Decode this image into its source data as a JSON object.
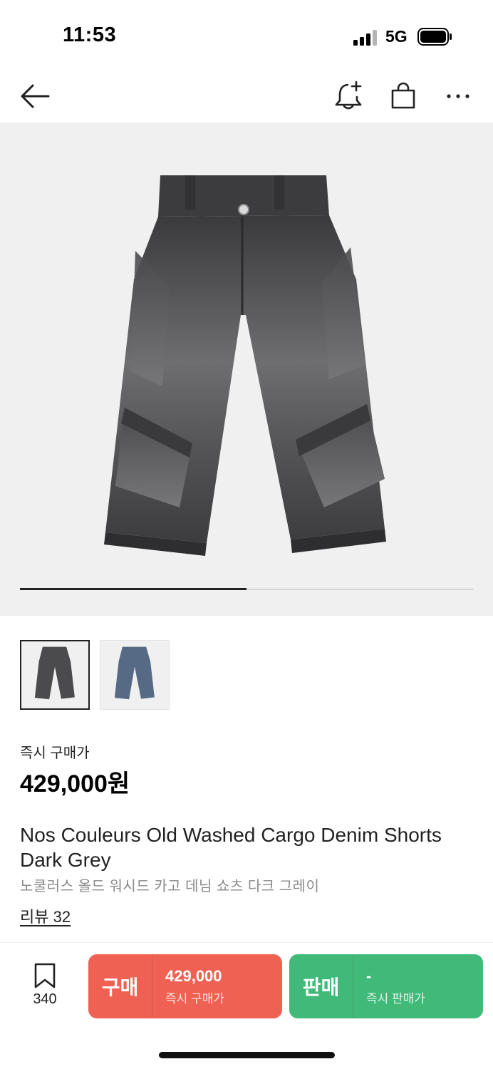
{
  "status_bar": {
    "time": "11:53",
    "network": "5G",
    "signal_bars": 4,
    "battery_level": 0.9
  },
  "nav": {
    "icons": [
      "back-arrow-icon",
      "bell-plus-icon",
      "shopping-bag-icon",
      "more-dots-icon"
    ]
  },
  "gallery": {
    "image_count": 2,
    "current_index": 0,
    "progress": 0.5,
    "thumbnails": [
      {
        "name": "dark-grey-shorts",
        "selected": true
      },
      {
        "name": "blue-shorts",
        "selected": false
      }
    ]
  },
  "product": {
    "price_label": "즉시 구매가",
    "price": "429,000원",
    "title_en": "Nos Couleurs Old Washed Cargo Denim Shorts Dark Grey",
    "title_ko": "노쿨러스 올드 워시드 카고 데님 쇼츠 다크 그레이",
    "reviews": "리뷰 32"
  },
  "bottom_bar": {
    "bookmark_count": "340",
    "buy": {
      "label": "구매",
      "price": "429,000",
      "caption": "즉시 구매가",
      "color": "#ef6253"
    },
    "sell": {
      "label": "판매",
      "price": "-",
      "caption": "즉시 판매가",
      "color": "#41b979"
    }
  }
}
